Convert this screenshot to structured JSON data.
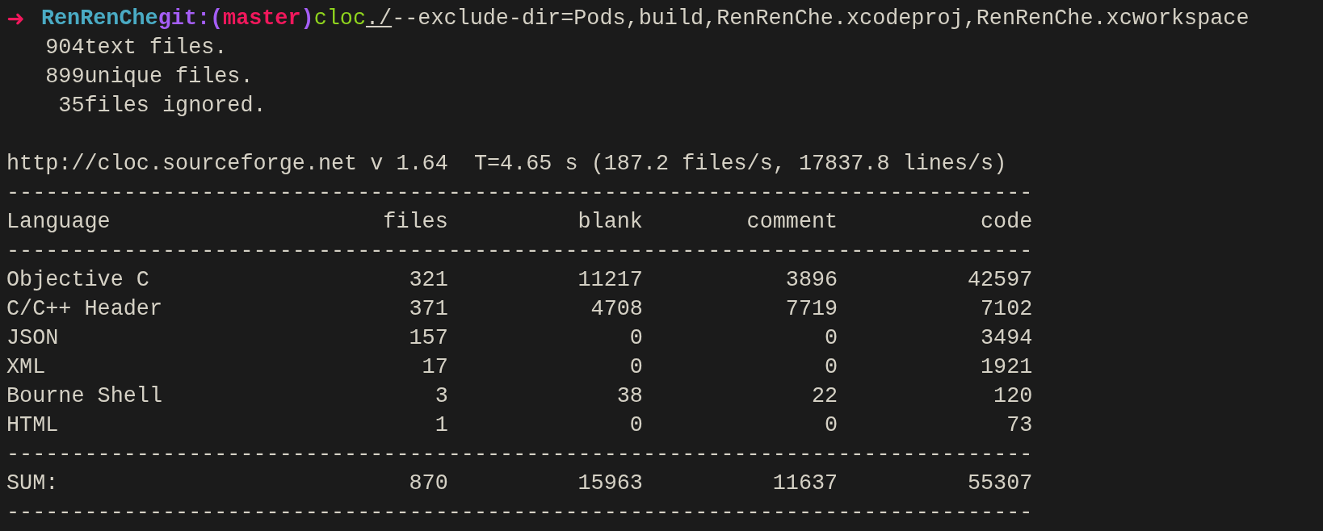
{
  "prompt": {
    "arrow": "➜",
    "directory": "RenRenChe",
    "git_prefix": "git:(",
    "branch": "master",
    "git_suffix": ")",
    "command": "cloc",
    "path": "./",
    "arguments": "--exclude-dir=Pods,build,RenRenChe.xcodeproj,RenRenChe.xcworkspace"
  },
  "file_counts": [
    {
      "count": "904",
      "label": "text files."
    },
    {
      "count": "899",
      "label": "unique files."
    },
    {
      "count": "35",
      "label": "files ignored."
    }
  ],
  "header_line": "http://cloc.sourceforge.net v 1.64  T=4.65 s (187.2 files/s, 17837.8 lines/s)",
  "table": {
    "separator": "-------------------------------------------------------------------------------",
    "columns": [
      "Language",
      "files",
      "blank",
      "comment",
      "code"
    ],
    "rows": [
      [
        "Objective C",
        "321",
        "11217",
        "3896",
        "42597"
      ],
      [
        "C/C++ Header",
        "371",
        "4708",
        "7719",
        "7102"
      ],
      [
        "JSON",
        "157",
        "0",
        "0",
        "3494"
      ],
      [
        "XML",
        "17",
        "0",
        "0",
        "1921"
      ],
      [
        "Bourne Shell",
        "3",
        "38",
        "22",
        "120"
      ],
      [
        "HTML",
        "1",
        "0",
        "0",
        "73"
      ]
    ],
    "sum": [
      "SUM:",
      "870",
      "15963",
      "11637",
      "55307"
    ]
  }
}
